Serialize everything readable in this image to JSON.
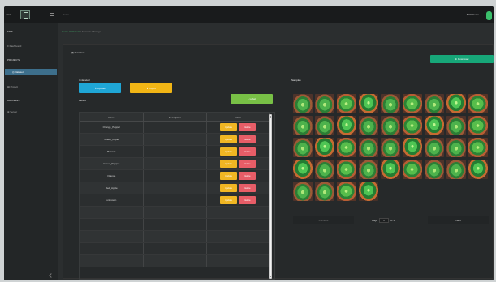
{
  "top": {
    "app_name": "TRIS",
    "title": "Home",
    "user": "■ Welcome"
  },
  "sidebar": {
    "items": [
      {
        "label": "≡ Dashboard"
      },
      {
        "label": "PROJECTS"
      },
      {
        "label": "◎ Dataset"
      },
      {
        "label": "▤ Project"
      },
      {
        "label": "ARCHIVES"
      },
      {
        "label": "⊕ Server"
      }
    ]
  },
  "breadcrumb": {
    "home": "Home",
    "datasets": "Datasets",
    "current": "Example Manage"
  },
  "main": {
    "panel_title": "Overview",
    "download_label": "⬇ Download",
    "unlabeled_label": "Unlabeled",
    "upload_label": "⬆ Upload",
    "import_label": "⬆ Import",
    "labels_label": "Labels",
    "add_label": "+ Label",
    "samples_title": "Samples",
    "table": {
      "headers": [
        "Name",
        "Description",
        "Action"
      ],
      "rows": [
        {
          "name": "Orange_Pepper",
          "description": ""
        },
        {
          "name": "Green_Apple",
          "description": ""
        },
        {
          "name": "Banana",
          "description": ""
        },
        {
          "name": "Green_Pepper",
          "description": ""
        },
        {
          "name": "Orange",
          "description": ""
        },
        {
          "name": "Red_Apple",
          "description": ""
        },
        {
          "name": "unknown",
          "description": ""
        },
        {
          "name": "",
          "description": ""
        },
        {
          "name": "",
          "description": ""
        },
        {
          "name": "",
          "description": ""
        },
        {
          "name": "",
          "description": ""
        },
        {
          "name": "",
          "description": ""
        }
      ],
      "update_label": "Update",
      "delete_label": "Delete"
    },
    "samples": {
      "count": 40
    },
    "pagination": {
      "previous": "Previous",
      "page_label": "Page",
      "current_page": "1",
      "of_label": "of 3",
      "next": "Next"
    }
  },
  "colors": {
    "accent": "#17a779",
    "blue": "#1fa6d6",
    "yellow": "#f1b515",
    "green": "#78c046",
    "delete": "#e75d67"
  }
}
